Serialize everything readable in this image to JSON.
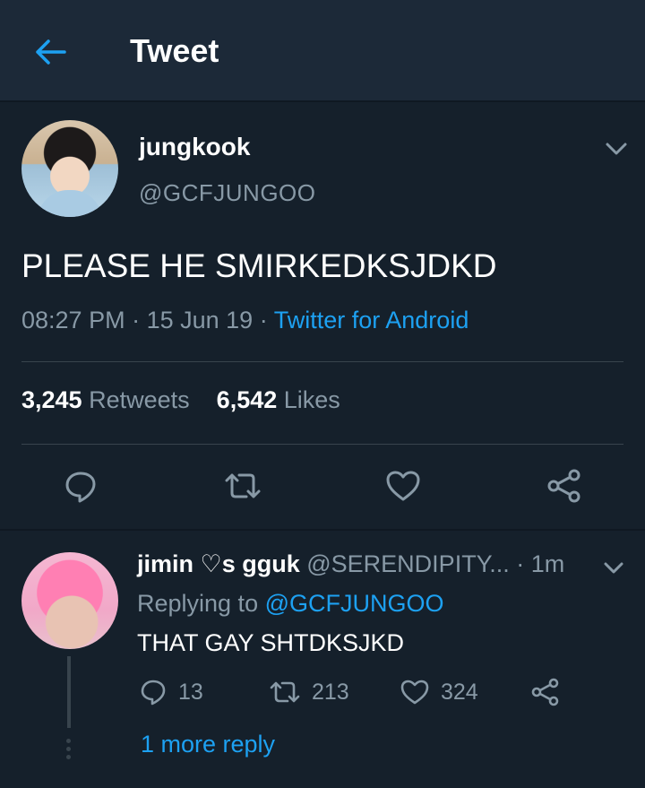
{
  "header": {
    "title": "Tweet",
    "back_icon": "arrow-left-icon"
  },
  "colors": {
    "accent": "#1da1f2",
    "muted": "#8899a6",
    "background": "#15202b",
    "header_bg": "#1c2938"
  },
  "tweet": {
    "name": "jungkook",
    "handle": "@GCFJUNGOO",
    "text": "PLEASE HE SMIRKEDKSJDKD",
    "time": "08:27 PM",
    "date": "15 Jun 19",
    "source": "Twitter for Android",
    "retweets_count": "3,245",
    "retweets_label": "Retweets",
    "likes_count": "6,542",
    "likes_label": "Likes",
    "actions": [
      "reply-icon",
      "retweet-icon",
      "like-icon",
      "share-icon"
    ]
  },
  "reply": {
    "name": "jimin ♡s gguk",
    "handle": "@SERENDIPITY...",
    "time": "1m",
    "replying_prefix": "Replying to",
    "replying_to": "@GCFJUNGOO",
    "text": "THAT GAY SHTDKSJKD",
    "reply_count": "13",
    "retweet_count": "213",
    "like_count": "324",
    "more_replies": "1 more reply"
  }
}
